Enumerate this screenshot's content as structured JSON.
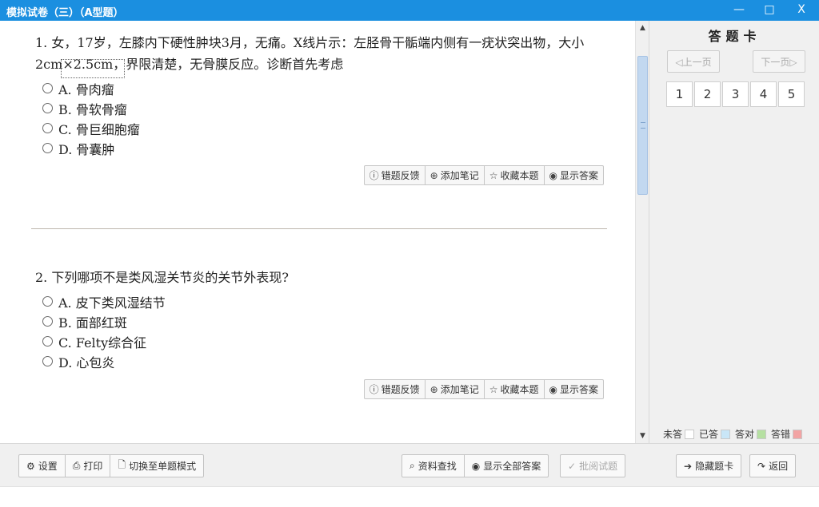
{
  "window": {
    "title": "模拟试卷（三）（A型题）",
    "minimize": "—",
    "maximize": "□",
    "close": "X"
  },
  "questions": [
    {
      "text": "1. 女，17岁，左膝内下硬性肿块3月，无痛。X线片示：左胫骨干骺端内侧有一疣状突出物，大小2cm×2.5cm，界限清楚，无骨膜反应。诊断首先考虑",
      "options": [
        "A. 骨肉瘤",
        "B. 骨软骨瘤",
        "C. 骨巨细胞瘤",
        "D. 骨囊肿"
      ]
    },
    {
      "text": "2. 下列哪项不是类风湿关节炎的关节外表现?",
      "options": [
        "A. 皮下类风湿结节",
        "B. 面部红斑",
        "C. Felty综合征",
        "D. 心包炎"
      ]
    }
  ],
  "question_tools": {
    "feedback": "错题反馈",
    "note": "添加笔记",
    "favorite": "收藏本题",
    "show_answer": "显示答案"
  },
  "answer_card": {
    "title": "答题卡",
    "prev": "◁上一页",
    "next": "下一页▷",
    "numbers": [
      "1",
      "2",
      "3",
      "4",
      "5"
    ],
    "legend": [
      {
        "label": "未答",
        "color": "#ffffff"
      },
      {
        "label": "已答",
        "color": "#c9e6f7"
      },
      {
        "label": "答对",
        "color": "#b6e0a2"
      },
      {
        "label": "答错",
        "color": "#f2a4a4"
      }
    ]
  },
  "bottom": {
    "settings": "设置",
    "print": "打印",
    "switch_mode": "切换至单题模式",
    "search": "资料查找",
    "show_all": "显示全部答案",
    "grade": "批阅试题",
    "hide_card": "隐藏题卡",
    "back": "返回"
  }
}
